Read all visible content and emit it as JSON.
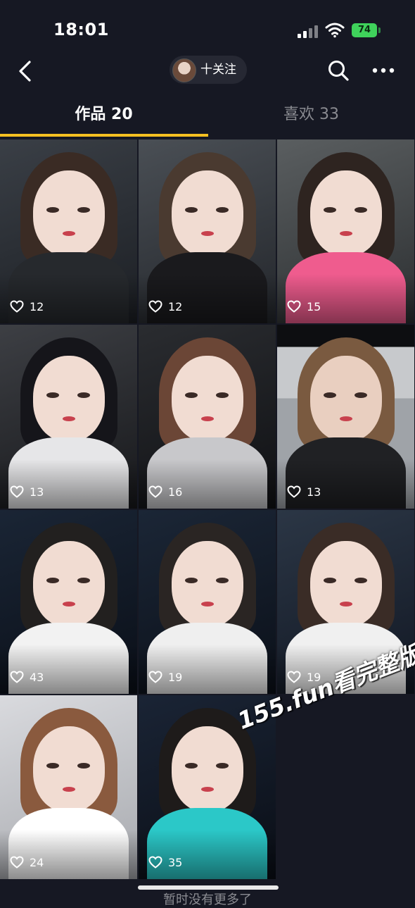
{
  "status_bar": {
    "time": "18:01",
    "battery": "74"
  },
  "nav": {
    "follow_label": "十关注"
  },
  "tabs": [
    {
      "label": "作品 20"
    },
    {
      "label": "喜欢 33"
    }
  ],
  "videos": [
    {
      "likes": "12"
    },
    {
      "likes": "12"
    },
    {
      "likes": "15"
    },
    {
      "likes": "13"
    },
    {
      "likes": "16"
    },
    {
      "likes": "13"
    },
    {
      "likes": "43"
    },
    {
      "likes": "19"
    },
    {
      "likes": "19"
    },
    {
      "likes": "24"
    },
    {
      "likes": "35"
    }
  ],
  "watermark": "155.fun看完整版",
  "footer": "暂时没有更多了",
  "colors": {
    "background": "#161823",
    "tab_indicator": "#f5c021",
    "battery": "#3fd25b"
  }
}
